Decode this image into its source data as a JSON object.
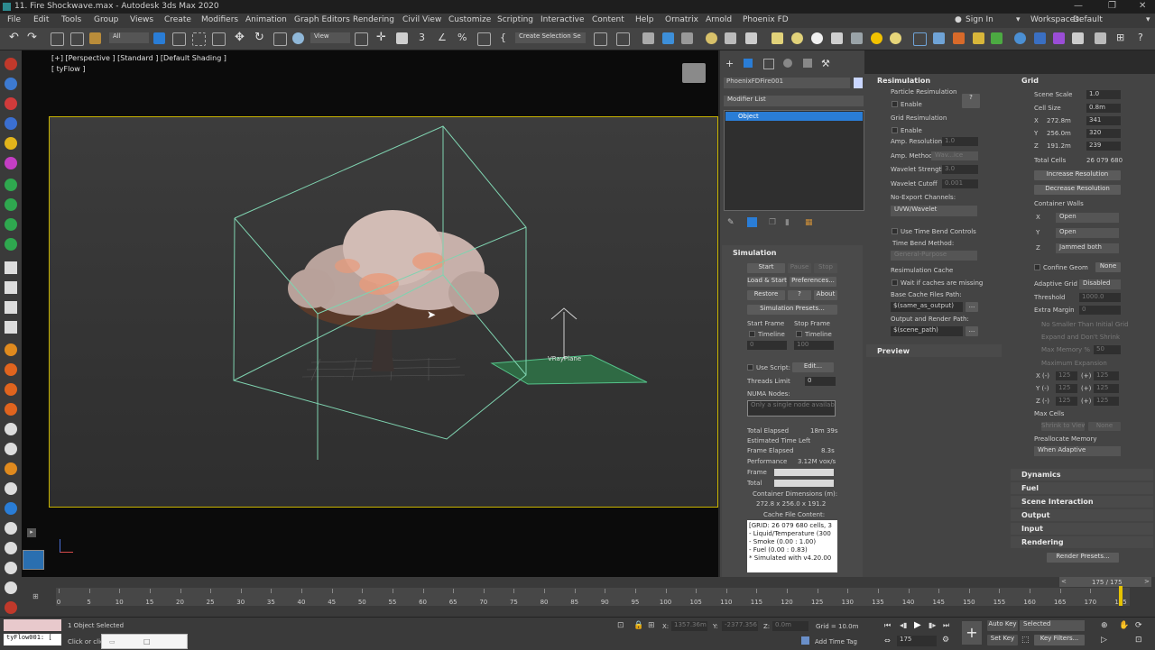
{
  "window": {
    "title": "11. Fire Shockwave.max - Autodesk 3ds Max 2020"
  },
  "menu": [
    "File",
    "Edit",
    "Tools",
    "Group",
    "Views",
    "Create",
    "Modifiers",
    "Animation",
    "Graph Editors",
    "Rendering",
    "Civil View",
    "Customize",
    "Scripting",
    "Interactive",
    "Content",
    "Help",
    "Ornatrix",
    "Arnold",
    "Phoenix FD"
  ],
  "account": {
    "sign_in": "Sign In",
    "workspaces_label": "Workspaces:",
    "workspace": "Default"
  },
  "toolbar": {
    "selection_filter": "All",
    "view_dropdown": "View",
    "selection_set": "Create Selection Se"
  },
  "viewport": {
    "label": "[+] [Perspective ] [Standard ] [Default Shading ]",
    "sublabel": "[ tyFlow ]",
    "object_label": "VRayPlane"
  },
  "modify": {
    "object_name": "PhoenixFDFire001",
    "modifier_list": "Modifier List",
    "stack_item": "Object"
  },
  "simulation": {
    "title": "Simulation",
    "start": "Start",
    "pause": "Pause",
    "stop": "Stop",
    "load_start": "Load & Start",
    "preferences": "Preferences...",
    "restore": "Restore",
    "help": "?",
    "about": "About",
    "presets": "Simulation Presets...",
    "start_frame": "Start Frame",
    "stop_frame": "Stop Frame",
    "timeline": "Timeline",
    "start_val": "0",
    "stop_val": "100",
    "use_script": "Use Script:",
    "edit": "Edit...",
    "threads_limit": "Threads Limit",
    "threads_val": "0",
    "numa": "NUMA Nodes:",
    "numa_placeholder": "Only a single node available.",
    "total_elapsed": "Total Elapsed",
    "total_elapsed_val": "18m 39s",
    "est_time_left": "Estimated Time Left",
    "frame_elapsed": "Frame Elapsed",
    "frame_elapsed_val": "8.3s",
    "performance": "Performance",
    "performance_val": "3.12M vox/s",
    "frame": "Frame",
    "total": "Total",
    "container_dims_label": "Container Dimensions (m):",
    "container_dims": "272.8 x 256.0 x 191.2",
    "cache_label": "Cache File Content:",
    "cache_lines": [
      "[GRID: 26 079 680 cells, 3",
      "- Liquid/Temperature (300",
      "- Smoke (0.00 : 1.00)",
      "- Fuel (0.00 : 0.83)",
      "* Simulated with v4.20.00"
    ]
  },
  "resimulation": {
    "title": "Resimulation",
    "particle_resim": "Particle Resimulation",
    "enable": "Enable",
    "help": "?",
    "grid_resim": "Grid Resimulation",
    "amp_resolution": "Amp. Resolution",
    "amp_resolution_val": "1.0",
    "amp_method": "Amp. Method",
    "amp_method_val": "Wav...ice",
    "wavelet_strength": "Wavelet Strength",
    "wavelet_strength_val": "3.0",
    "wavelet_cutoff": "Wavelet Cutoff",
    "wavelet_cutoff_val": "0.001",
    "no_export": "No-Export Channels:",
    "no_export_val": "UVW/Wavelet",
    "use_time_bend": "Use Time Bend Controls",
    "time_bend_method": "Time Bend Method:",
    "time_bend_val": "General-Purpose",
    "resim_cache": "Resimulation Cache",
    "wait_caches": "Wait if caches are missing",
    "base_cache_path": "Base Cache Files Path:",
    "base_cache_val": "$(same_as_output)",
    "output_render_path": "Output and Render Path:",
    "output_render_val": "$(scene_path)",
    "browse": "...",
    "preview": "Preview"
  },
  "grid": {
    "title": "Grid",
    "scene_scale": "Scene Scale",
    "scene_scale_val": "1.0",
    "cell_size": "Cell Size",
    "cell_size_val": "0.8m",
    "x": "X",
    "x_m": "272.8m",
    "x_cells": "341",
    "y": "Y",
    "y_m": "256.0m",
    "y_cells": "320",
    "z": "Z",
    "z_m": "191.2m",
    "z_cells": "239",
    "total_cells": "Total Cells",
    "total_cells_val": "26 079 680",
    "increase": "Increase Resolution",
    "decrease": "Decrease Resolution",
    "container_walls": "Container Walls",
    "wall_x": "Open",
    "wall_y": "Open",
    "wall_z": "Jammed both",
    "confine_geom": "Confine Geom",
    "confine_none": "None",
    "adaptive_grid": "Adaptive Grid",
    "adaptive_val": "Disabled",
    "threshold": "Threshold",
    "threshold_val": "1000.0",
    "extra_margin": "Extra Margin",
    "extra_margin_val": "0",
    "no_smaller": "No Smaller Than Initial Grid",
    "expand_shrink": "Expand and Don't Shrink",
    "max_memory": "Max Memory %",
    "max_memory_val": "50",
    "max_expansion": "Maximum Expansion",
    "xm": "X (-)",
    "xp": "(+)",
    "ym": "Y (-)",
    "yp": "(+)",
    "zm": "Z (-)",
    "zp": "(+)",
    "exp_val": "125",
    "max_cells": "Max Cells",
    "shrink_view": "Shrink to View",
    "shrink_none": "None",
    "prealloc": "Preallocate Memory",
    "prealloc_val": "When Adaptive",
    "rollouts": [
      "Dynamics",
      "Fuel",
      "Scene Interaction",
      "Output",
      "Input",
      "Rendering"
    ],
    "render_presets": "Render Presets..."
  },
  "timeline": {
    "frame_counter": "175 / 175",
    "ticks": [
      "0",
      "5",
      "10",
      "15",
      "20",
      "25",
      "30",
      "35",
      "40",
      "45",
      "50",
      "55",
      "60",
      "65",
      "70",
      "75",
      "80",
      "85",
      "90",
      "95",
      "100",
      "105",
      "110",
      "115",
      "120",
      "125",
      "130",
      "135",
      "140",
      "145",
      "150",
      "155",
      "160",
      "165",
      "170",
      "175"
    ]
  },
  "status": {
    "maxscript": "tyFlow001: [",
    "selected": "1 Object Selected",
    "hint": "Click or click",
    "x_label": "X:",
    "x_val": "1357.36m",
    "y_label": "Y:",
    "y_val": "-2377.356",
    "z_label": "Z:",
    "z_val": "0.0m",
    "grid": "Grid = 10.0m",
    "add_time_tag": "Add Time Tag",
    "current_frame": "175",
    "auto_key": "Auto Key",
    "set_key": "Set Key",
    "selected_dd": "Selected",
    "key_filters": "Key Filters..."
  },
  "colors": {
    "accent": "#2a7dd6",
    "viewport_border": "#c8b400",
    "gizmo": "#7fd3b0"
  }
}
